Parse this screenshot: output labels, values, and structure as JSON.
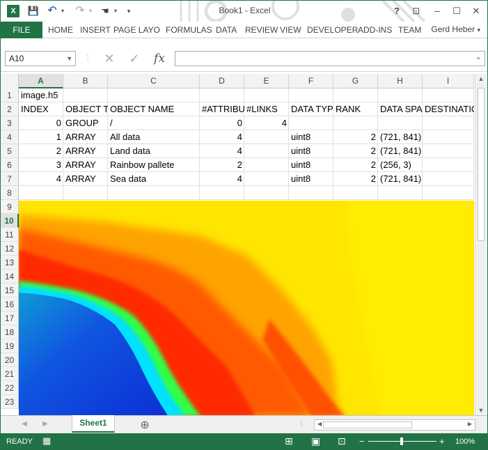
{
  "titlebar": {
    "title": "Book1 - Excel",
    "help": "?",
    "minimize": "–",
    "maximize": "☐",
    "close": "✕",
    "qat": {
      "save": "💾",
      "undo": "↶",
      "redo": "↷",
      "touch": "☚",
      "customize": "▾"
    }
  },
  "ribbon": {
    "file": "FILE",
    "tabs": [
      "HOME",
      "INSERT",
      "PAGE LAYO",
      "FORMULAS",
      "DATA",
      "REVIEW",
      "VIEW",
      "DEVELOPER",
      "ADD-INS",
      "TEAM"
    ],
    "user": "Gerd Heber",
    "user_caret": "▾"
  },
  "formula_bar": {
    "name_box": "A10",
    "cancel": "✕",
    "enter": "✓",
    "fx": "fx",
    "value": ""
  },
  "grid": {
    "columns": [
      "A",
      "B",
      "C",
      "D",
      "E",
      "F",
      "G",
      "H",
      "I"
    ],
    "selected_column": "A",
    "rows": [
      "1",
      "2",
      "3",
      "4",
      "5",
      "6",
      "7",
      "8",
      "9",
      "10",
      "11",
      "12",
      "13",
      "14",
      "15",
      "16",
      "17",
      "18",
      "19",
      "20",
      "21",
      "22",
      "23"
    ],
    "selected_row": "10",
    "cells": {
      "A1": "image.h5",
      "A2": "INDEX",
      "B2": "OBJECT TY",
      "C2": "OBJECT NAME",
      "D2": "#ATTRIBUT",
      "E2": "#LINKS",
      "F2": "DATA TYP",
      "G2": "RANK",
      "H2": "DATA SPA",
      "I2": "DESTINATIO",
      "A3": "0",
      "B3": "GROUP",
      "C3": "/",
      "D3": "0",
      "E3": "4",
      "A4": "1",
      "B4": "ARRAY",
      "C4": "All data",
      "D4": "4",
      "F4": "uint8",
      "G4": "2",
      "H4": "(721, 841)",
      "A5": "2",
      "B5": "ARRAY",
      "C5": "Land data",
      "D5": "4",
      "F5": "uint8",
      "G5": "2",
      "H5": "(721, 841)",
      "A6": "3",
      "B6": "ARRAY",
      "C6": "Rainbow pallete",
      "D6": "2",
      "F6": "uint8",
      "G6": "2",
      "H6": "(256, 3)",
      "A7": "4",
      "B7": "ARRAY",
      "C7": "Sea data",
      "D7": "4",
      "F7": "uint8",
      "G7": "2",
      "H7": "(721, 841)"
    }
  },
  "sheets": {
    "active": "Sheet1",
    "add": "⊕"
  },
  "status": {
    "mode": "READY",
    "zoom": "100%",
    "zoom_out": "−",
    "zoom_in": "+"
  },
  "colors": {
    "accent": "#217346"
  }
}
